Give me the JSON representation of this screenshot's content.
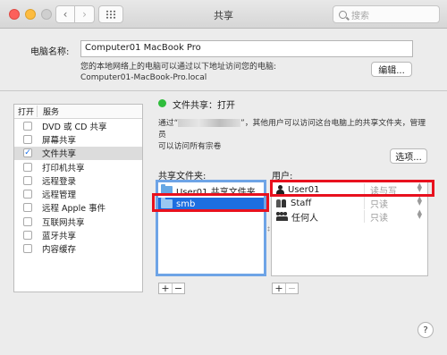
{
  "window": {
    "title": "共享"
  },
  "search": {
    "placeholder": "搜索"
  },
  "computer_name": {
    "label": "电脑名称:",
    "value": "Computer01 MacBook Pro",
    "description_line1": "您的本地网络上的电脑可以通过以下地址访问您的电脑:",
    "description_line2": "Computer01-MacBook-Pro.local",
    "edit_label": "编辑..."
  },
  "services": {
    "header_open": "打开",
    "header_service": "服务",
    "items": [
      {
        "label": "DVD 或 CD 共享",
        "checked": false
      },
      {
        "label": "屏幕共享",
        "checked": false
      },
      {
        "label": "文件共享",
        "checked": true
      },
      {
        "label": "打印机共享",
        "checked": false
      },
      {
        "label": "远程登录",
        "checked": false
      },
      {
        "label": "远程管理",
        "checked": false
      },
      {
        "label": "远程 Apple 事件",
        "checked": false
      },
      {
        "label": "互联网共享",
        "checked": false
      },
      {
        "label": "蓝牙共享",
        "checked": false
      },
      {
        "label": "内容缓存",
        "checked": false
      }
    ],
    "check_mark": "✓"
  },
  "file_sharing": {
    "status": "文件共享：打开",
    "status_color": "#2fbd3c",
    "desc_prefix": "通过“",
    "desc_suffix": "”，其他用户可以访问这台电脑上的共享文件夹，管理员",
    "desc_line2": "可以访问所有宗卷",
    "options_label": "选项..."
  },
  "shared_folders": {
    "label": "共享文件夹:",
    "items": [
      {
        "name": "User01 共享文件夹"
      },
      {
        "name": "smb"
      }
    ]
  },
  "users": {
    "label": "用户:",
    "items": [
      {
        "name": "User01",
        "permission": "读与写",
        "icon": "person-icon"
      },
      {
        "name": "Staff",
        "permission": "只读",
        "icon": "group-icon"
      },
      {
        "name": "任何人",
        "permission": "只读",
        "icon": "everyone-icon"
      }
    ]
  },
  "buttons": {
    "plus": "+",
    "minus": "−",
    "help": "?"
  },
  "colors": {
    "highlight": "#e8111e",
    "selection": "#1d6ee0",
    "accent": "#6ea4e6"
  }
}
